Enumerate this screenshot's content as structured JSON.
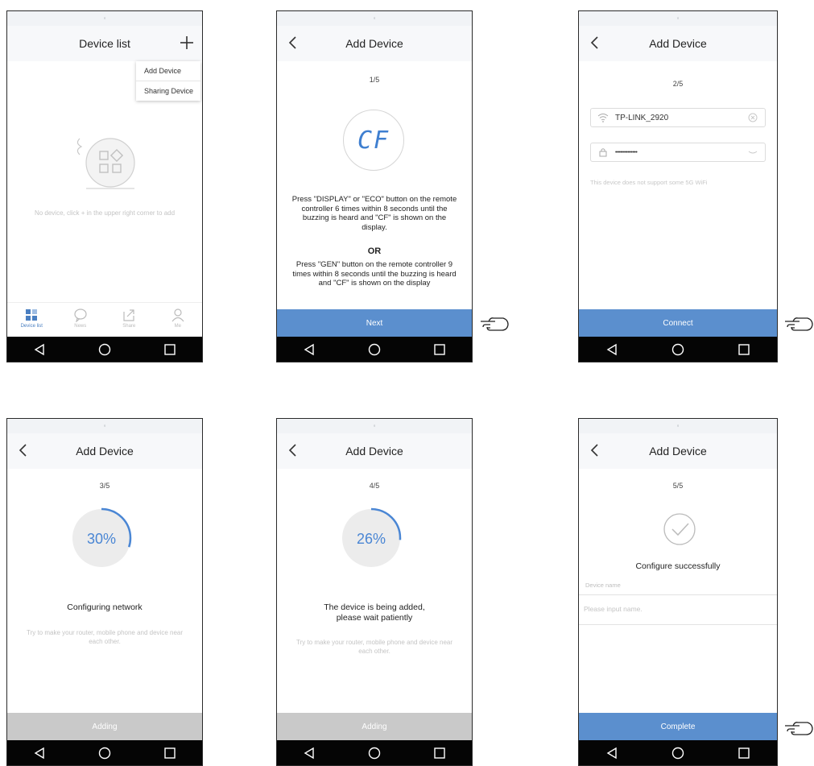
{
  "colors": {
    "accent": "#5b8fce",
    "progress_arc": "#4a86d4",
    "disabled": "#c9c9c9",
    "nav": "#050505"
  },
  "screen1": {
    "title": "Device list",
    "menu": [
      "Add Device",
      "Sharing Device"
    ],
    "empty_text": "No device, click + in the upper right corner to add",
    "tabs": [
      {
        "label": "Device list",
        "icon": "grid-icon",
        "active": true
      },
      {
        "label": "News",
        "icon": "chat-bubble-icon",
        "active": false
      },
      {
        "label": "Share",
        "icon": "share-icon",
        "active": false
      },
      {
        "label": "Me",
        "icon": "person-icon",
        "active": false
      }
    ]
  },
  "screen2": {
    "title": "Add Device",
    "step": "1/5",
    "display_code": "CF",
    "instruction1": "Press \"DISPLAY\" or \"ECO\" button on the remote controller 6 times within 8 seconds until the buzzing is heard and \"CF\" is shown on the display.",
    "or": "OR",
    "instruction2": "Press \"GEN\" button on the remote controller 9 times within 8 seconds until the buzzing is heard and \"CF\" is shown on the display",
    "button": "Next"
  },
  "screen3": {
    "title": "Add Device",
    "step": "2/5",
    "wifi_name": "TP-LINK_2920",
    "password_masked": "••••••••••••••",
    "hint": "This device does not support some 5G WiFi",
    "button": "Connect"
  },
  "screen4": {
    "title": "Add Device",
    "step": "3/5",
    "progress": 30,
    "progress_label": "30%",
    "status": "Configuring network",
    "tip": "Try to make your router, mobile phone and device near each other.",
    "button": "Adding"
  },
  "screen5": {
    "title": "Add Device",
    "step": "4/5",
    "progress": 26,
    "progress_label": "26%",
    "status_line1": "The device is being added,",
    "status_line2": "please wait patiently",
    "tip": "Try to make your router, mobile phone and device near each other.",
    "button": "Adding"
  },
  "screen6": {
    "title": "Add Device",
    "step": "5/5",
    "status": "Configure successfully",
    "device_name_label": "Device name",
    "device_name_placeholder": "Please input name.",
    "button": "Complete"
  }
}
